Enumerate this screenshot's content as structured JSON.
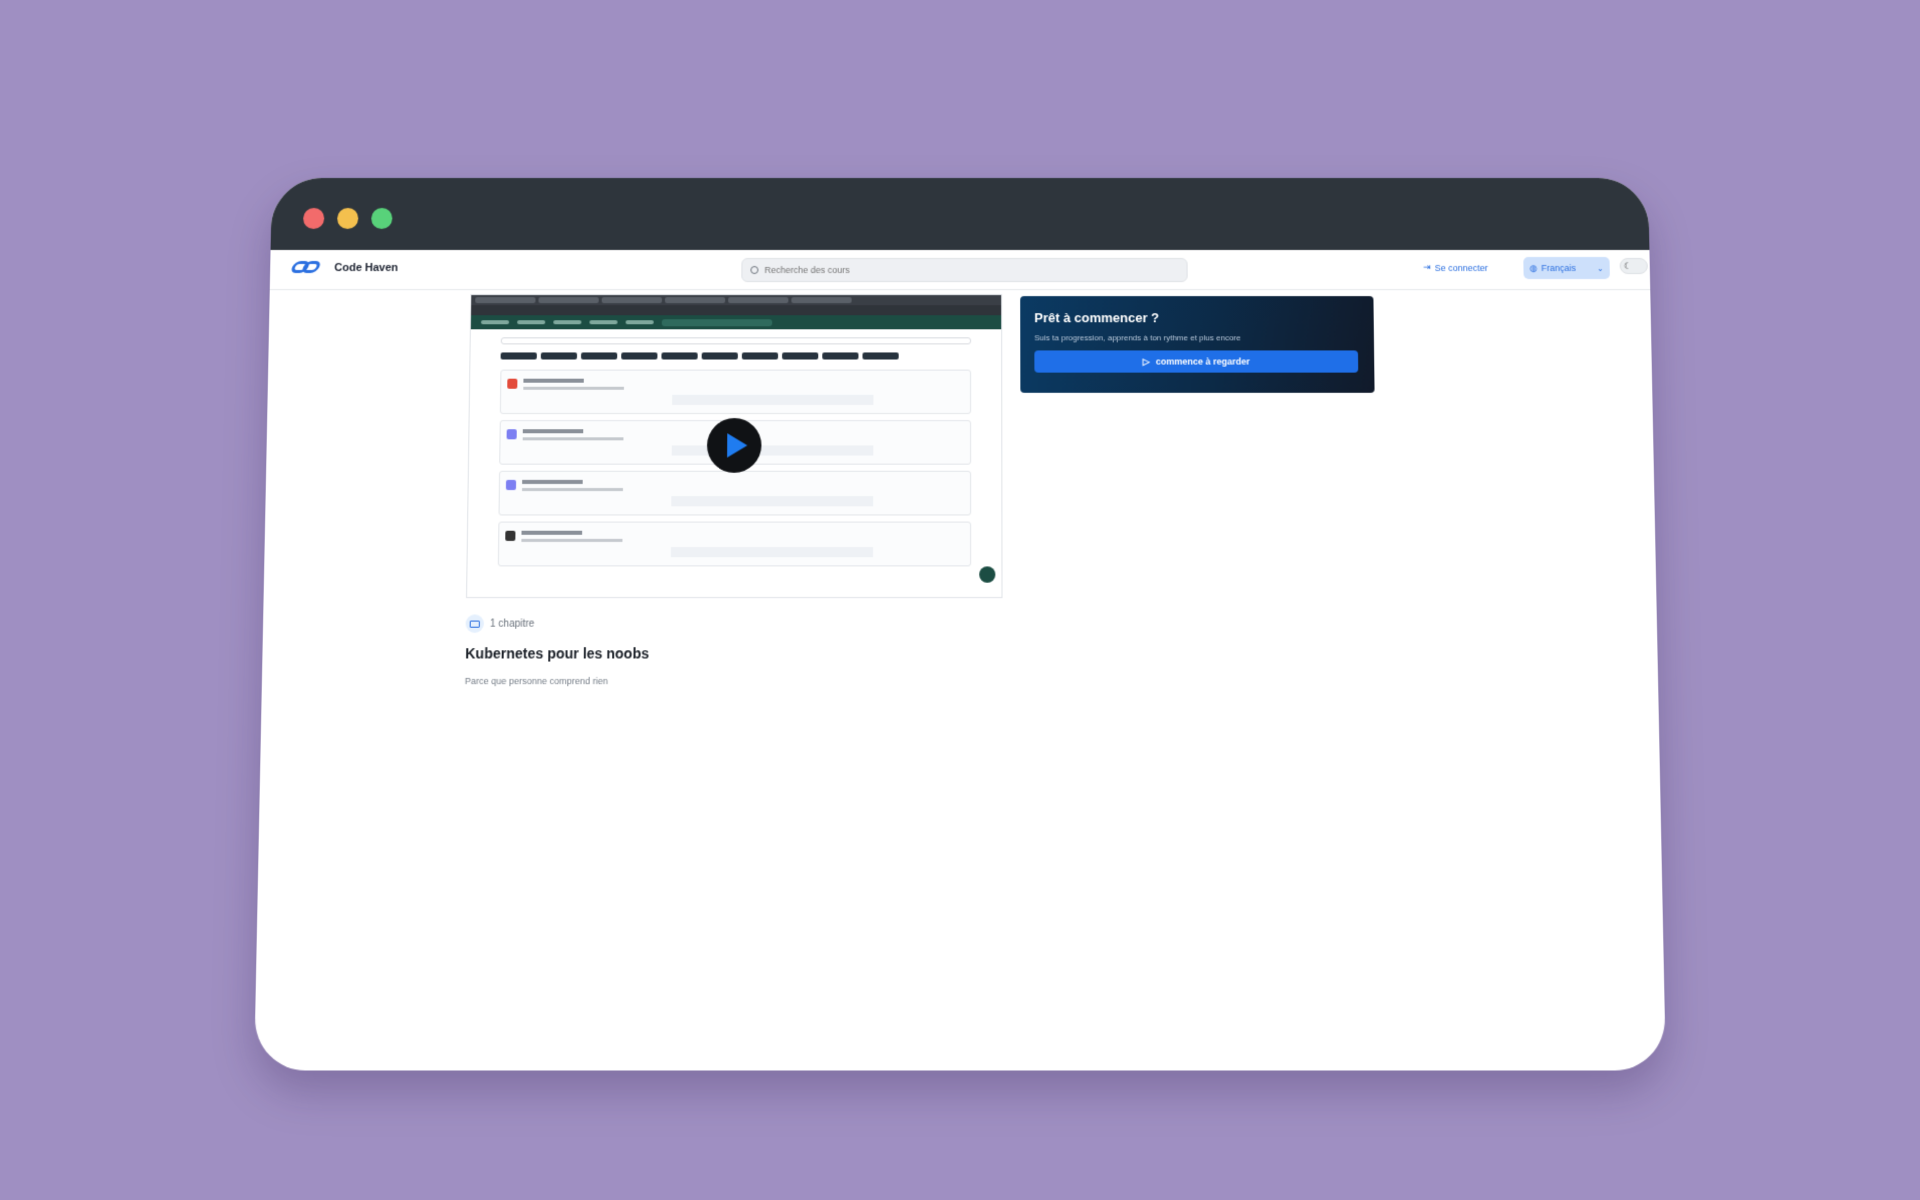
{
  "app": {
    "name": "Code Haven"
  },
  "header": {
    "search_placeholder": "Recherche des cours",
    "login_label": "Se connecter",
    "language_label": "Français"
  },
  "course": {
    "chapters_label": "1 chapitre",
    "title": "Kubernetes pour les noobs",
    "description": "Parce que personne comprend rien"
  },
  "cta": {
    "title": "Prêt à commencer ?",
    "subtitle": "Suis ta progression, apprends à ton rythme et plus encore",
    "button_label": "commence à regarder"
  },
  "colors": {
    "background": "#9f8fc2",
    "titlebar": "#2e353c",
    "accent": "#2b6fe0",
    "cta_button": "#1f6fe8"
  },
  "icons": {
    "search": "search-icon",
    "login": "login-icon",
    "language": "globe-icon",
    "theme": "moon-icon",
    "chapters": "book-icon",
    "play": "play-icon"
  }
}
